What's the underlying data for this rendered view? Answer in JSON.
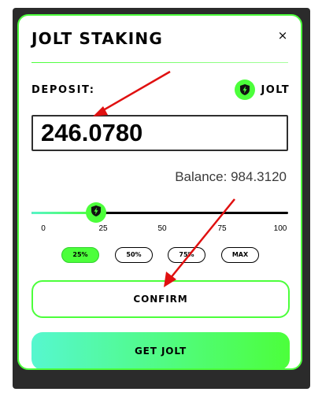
{
  "modal": {
    "title": "JOLT STAKING",
    "close_symbol": "×"
  },
  "deposit": {
    "label": "DEPOSIT:",
    "token_name": "JOLT",
    "token_icon": "bolt-shield-icon",
    "amount": "246.0780",
    "balance_text": "Balance: 984.3120"
  },
  "slider": {
    "value_percent": 25,
    "ticks": [
      "0",
      "25",
      "50",
      "75",
      "100"
    ]
  },
  "percent_buttons": [
    {
      "label": "25%",
      "active": true
    },
    {
      "label": "50%",
      "active": false
    },
    {
      "label": "75%",
      "active": false
    },
    {
      "label": "MAX",
      "active": false
    }
  ],
  "actions": {
    "confirm_label": "CONFIRM",
    "get_jolt_label": "GET JOLT"
  },
  "colors": {
    "accent": "#4cff3b",
    "accent_teal": "#56f7cf",
    "annotation_arrow": "#e01010"
  }
}
